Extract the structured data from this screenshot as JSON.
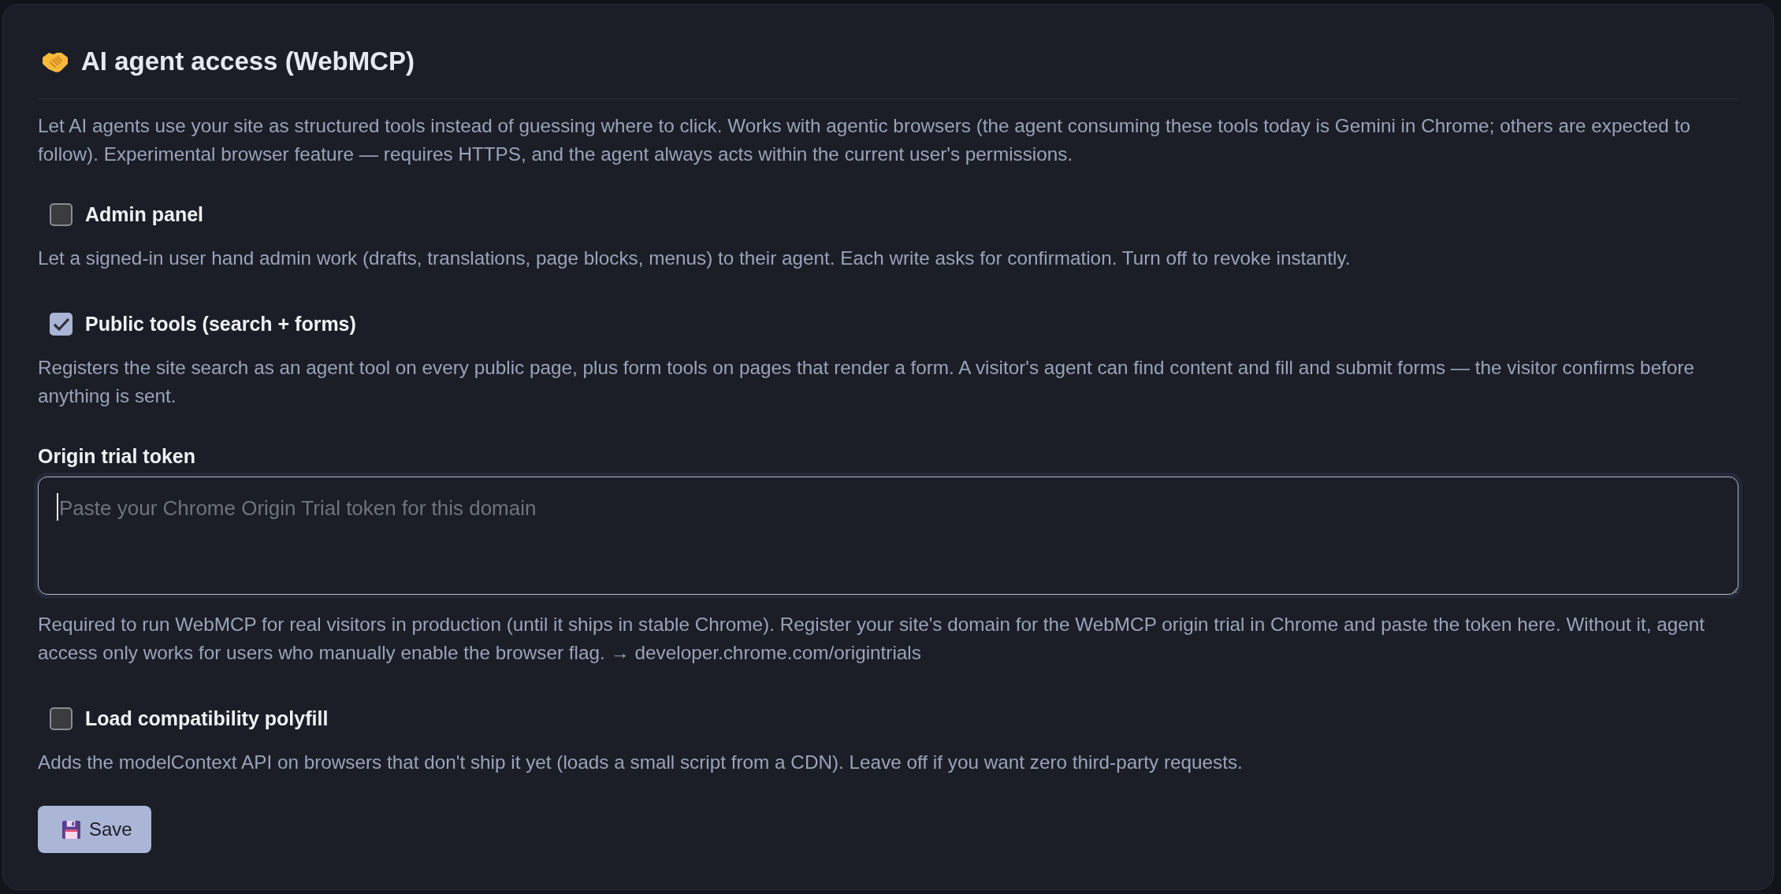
{
  "section": {
    "title": "AI agent access (WebMCP)",
    "description": "Let AI agents use your site as structured tools instead of guessing where to click. Works with agentic browsers (the agent consuming these tools today is Gemini in Chrome; others are expected to follow). Experimental browser feature — requires HTTPS, and the agent always acts within the current user's permissions."
  },
  "options": [
    {
      "kind": "checkbox",
      "label": "Admin panel",
      "checked": false,
      "description": "Let a signed-in user hand admin work (drafts, translations, page blocks, menus) to their agent. Each write asks for confirmation. Turn off to revoke instantly."
    },
    {
      "kind": "checkbox",
      "label": "Public tools (search + forms)",
      "checked": true,
      "description": "Registers the site search as an agent tool on every public page, plus form tools on pages that render a form. A visitor's agent can find content and fill and submit forms — the visitor confirms before anything is sent."
    },
    {
      "kind": "textarea",
      "label": "Origin trial token",
      "placeholder": "Paste your Chrome Origin Trial token for this domain",
      "focused": true,
      "description": "Required to run WebMCP for real visitors in production (until it ships in stable Chrome). Register your site's domain for the WebMCP origin trial in Chrome and paste the token here. Without it, agent access only works for users who manually enable the browser flag. → developer.chrome.com/origintrials"
    },
    {
      "kind": "checkbox",
      "label": "Load compatibility polyfill",
      "checked": false,
      "description": "Adds the modelContext API on browsers that don't ship it yet (loads a small script from a CDN). Leave off if you want zero third-party requests."
    }
  ],
  "buttons": [
    {
      "label": "Save"
    }
  ]
}
